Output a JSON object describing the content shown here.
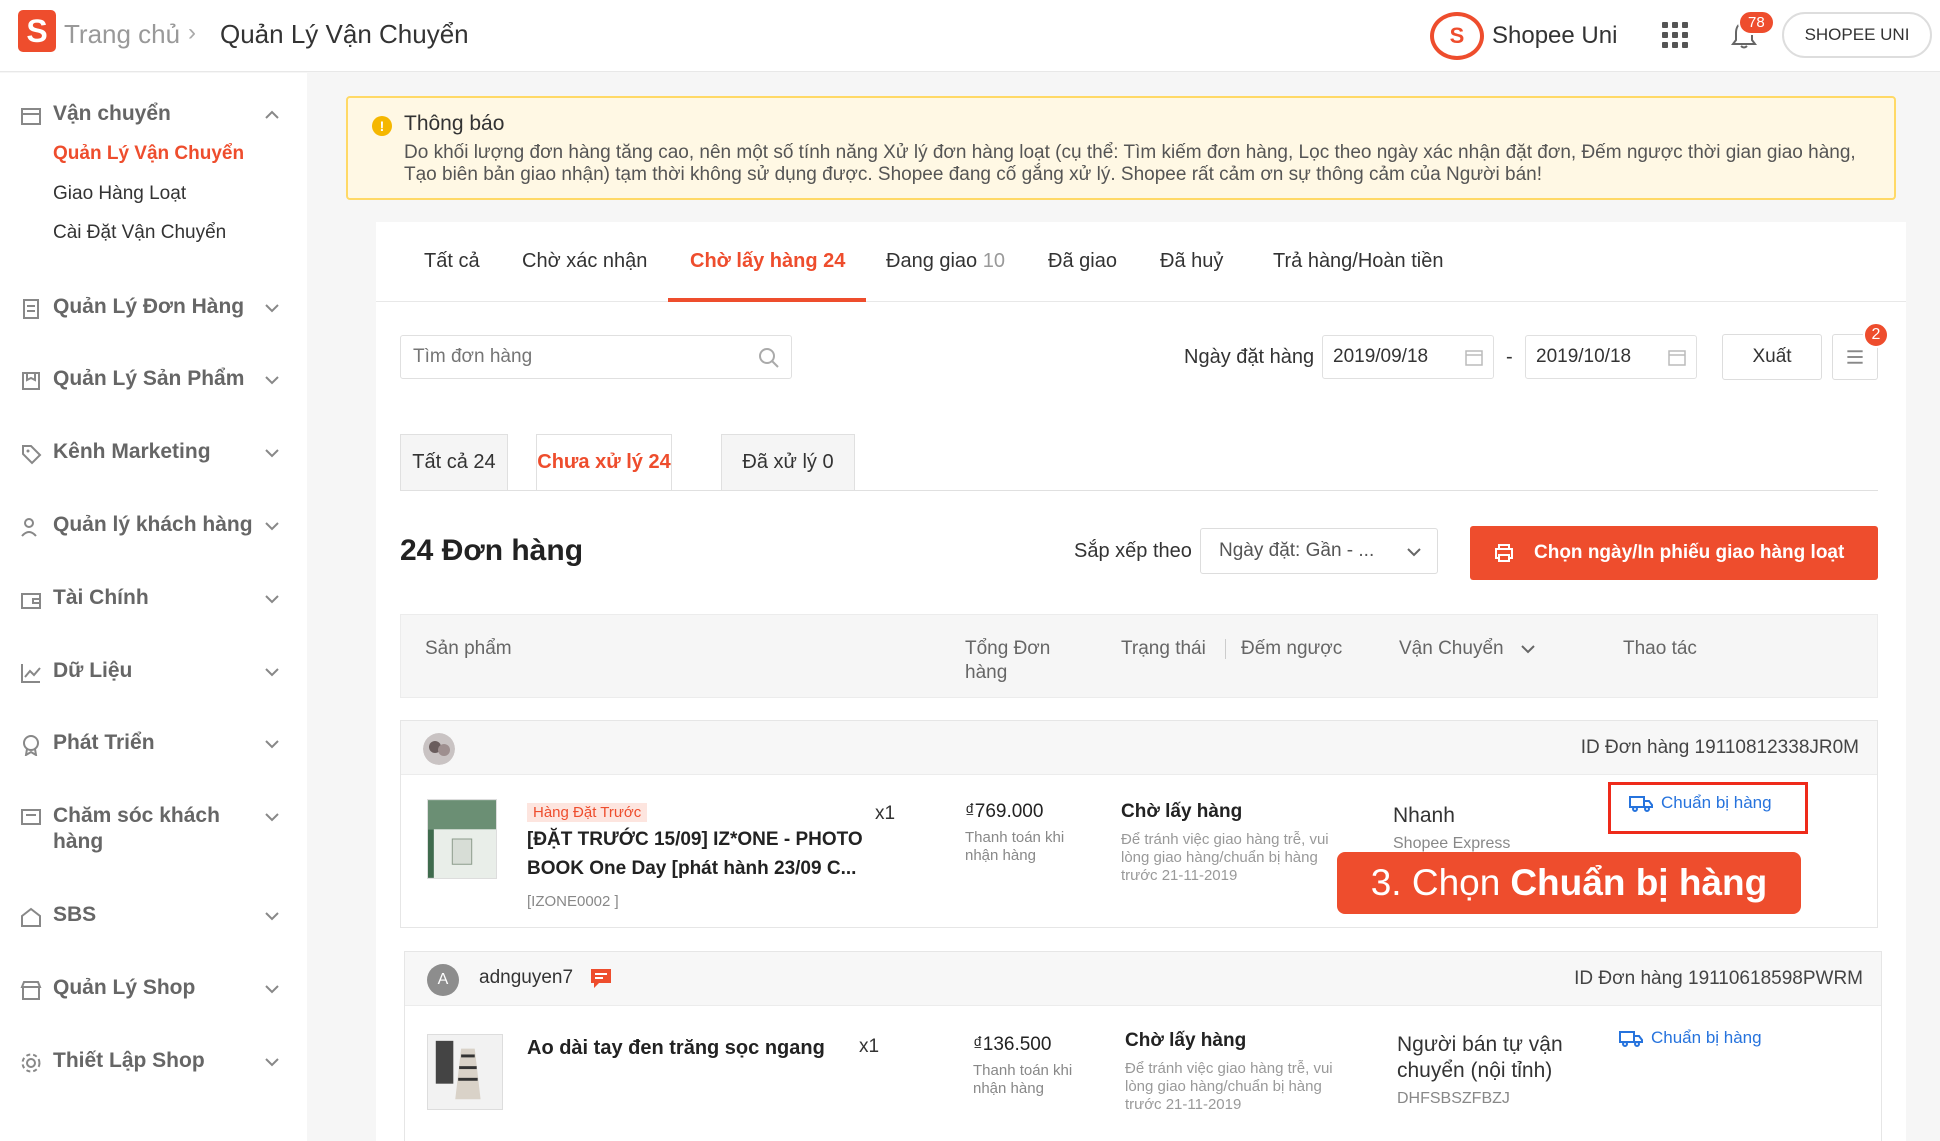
{
  "header": {
    "logo_letter": "S",
    "breadcrumb_home": "Trang chủ",
    "breadcrumb_current": "Quản Lý Vận Chuyển",
    "uni_text": "Shopee Uni",
    "notification_count": "78",
    "shop_button": "SHOPEE UNI"
  },
  "sidebar": {
    "shipping": {
      "label": "Vận chuyển",
      "subs": [
        "Quản Lý Vận Chuyển",
        "Giao Hàng Loạt",
        "Cài Đặt Vận Chuyển"
      ]
    },
    "items": [
      "Quản Lý Đơn Hàng",
      "Quản Lý Sản Phẩm",
      "Kênh Marketing",
      "Quản lý khách hàng",
      "Tài Chính",
      "Dữ Liệu",
      "Phát Triển",
      "Chăm sóc khách hàng",
      "SBS",
      "Quản Lý Shop",
      "Thiết Lập Shop"
    ]
  },
  "notice": {
    "title": "Thông báo",
    "body": "Do khối lượng đơn hàng tăng cao, nên một số tính năng Xử lý đơn hàng loạt (cụ thể: Tìm kiếm đơn hàng, Lọc theo ngày xác nhận đặt đơn, Đếm ngược thời gian giao hàng, Tạo biên bản giao nhận) tạm thời không sử dụng được. Shopee đang cố gắng xử lý. Shopee rất cảm ơn sự thông cảm của Người bán!"
  },
  "tabs": [
    {
      "label": "Tất cả",
      "count": ""
    },
    {
      "label": "Chờ xác nhận",
      "count": ""
    },
    {
      "label": "Chờ lấy hàng",
      "count": "24"
    },
    {
      "label": "Đang giao",
      "count": "10"
    },
    {
      "label": "Đã giao",
      "count": ""
    },
    {
      "label": "Đã huỷ",
      "count": ""
    },
    {
      "label": "Trả hàng/Hoàn tiền",
      "count": ""
    }
  ],
  "filters": {
    "search_placeholder": "Tìm đơn hàng",
    "date_label": "Ngày đặt hàng",
    "date_from": "2019/09/18",
    "date_sep": "-",
    "date_to": "2019/10/18",
    "export_label": "Xuất",
    "list_badge": "2"
  },
  "subtabs": [
    "Tất cả 24",
    "Chưa xử lý 24",
    "Đã xử lý 0"
  ],
  "summary": {
    "order_count": "24 Đơn hàng",
    "sort_label": "Sắp xếp theo",
    "sort_value": "Ngày đặt: Gần - ...",
    "bulk_button": "Chọn ngày/In phiếu giao hàng loạt"
  },
  "table_headers": {
    "product": "Sản phẩm",
    "total_line1": "Tổng Đơn",
    "total_line2": "hàng",
    "status": "Trạng thái",
    "countdown": "Đếm ngược",
    "shipping": "Vận Chuyển",
    "action": "Thao tác"
  },
  "orders": [
    {
      "buyer": "",
      "order_id": "ID Đơn hàng 19110812338JR0M",
      "badge": "Hàng Đặt Trước",
      "product_name": "[ĐẶT TRƯỚC 15/09] IZ*ONE - PHOTO BOOK One Day [phát hành 23/09 C...",
      "sku": "[IZONE0002 ]",
      "qty": "x1",
      "price": "₫769.000",
      "payment": "Thanh toán khi nhận hàng",
      "status": "Chờ lấy hàng",
      "status_note": "Để tránh việc giao hàng trễ, vui lòng giao hàng/chuẩn bị hàng trước 21-11-2019",
      "shipping": "Nhanh",
      "shipping_sub": "Shopee Express",
      "action": "Chuẩn bị hàng"
    },
    {
      "buyer": "adnguyen7",
      "avatar_letter": "A",
      "order_id": "ID Đơn hàng 19110618598PWRM",
      "product_name": "Ao dài tay đen trăng sọc ngang",
      "qty": "x1",
      "price": "₫136.500",
      "payment": "Thanh toán khi nhận hàng",
      "status": "Chờ lấy hàng",
      "status_note": "Để tránh việc giao hàng trễ, vui lòng giao hàng/chuẩn bị hàng trước 21-11-2019",
      "shipping": "Người bán tự vận chuyển (nội tỉnh)",
      "shipping_sub": "DHFSBSZFBZJ",
      "action": "Chuẩn bị hàng"
    }
  ],
  "callout": {
    "prefix": "3. Chọn",
    "bold": "Chuẩn bị hàng"
  },
  "colors": {
    "brand": "#ee4d2d",
    "link": "#2673dd",
    "notice_bg": "#fff8e4",
    "notice_border": "#ffd966"
  }
}
